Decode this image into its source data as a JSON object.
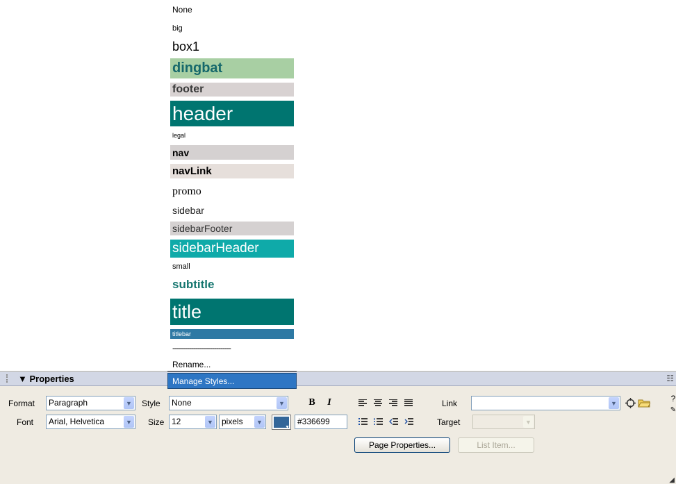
{
  "style_menu": {
    "options": [
      "None",
      "big",
      "box1",
      "dingbat",
      "footer",
      "header",
      "legal",
      "nav",
      "navLink",
      "promo",
      "sidebar",
      "sidebarFooter",
      "sidebarHeader",
      "small",
      "subtitle",
      "title",
      "titlebar"
    ],
    "separator": "----------------------------",
    "rename_label": "Rename...",
    "manage_styles_label": "Manage Styles..."
  },
  "properties": {
    "title": "Properties",
    "format_label": "Format",
    "format_value": "Paragraph",
    "style_label": "Style",
    "style_value": "None",
    "font_label": "Font",
    "font_value": "Arial, Helvetica",
    "size_label": "Size",
    "size_value": "12",
    "units_value": "pixels",
    "color_value": "#336699",
    "bold_label": "B",
    "italic_label": "I",
    "link_label": "Link",
    "link_value": "",
    "target_label": "Target",
    "target_value": "",
    "page_properties_label": "Page Properties...",
    "list_item_label": "List Item..."
  },
  "icons": {
    "align": [
      "align-left-icon",
      "align-center-icon",
      "align-right-icon",
      "justify-icon"
    ],
    "lists": [
      "unordered-list-icon",
      "ordered-list-icon",
      "outdent-icon",
      "indent-icon"
    ],
    "link": [
      "point-to-file-icon",
      "browse-folder-icon"
    ],
    "help": [
      "help-icon",
      "quick-tag-editor-icon"
    ]
  },
  "colors": {
    "selection": "#2e76c4",
    "panel_bg": "#efebe2",
    "panel_header": "#d2d7e5",
    "text_color_swatch": "#336699"
  }
}
